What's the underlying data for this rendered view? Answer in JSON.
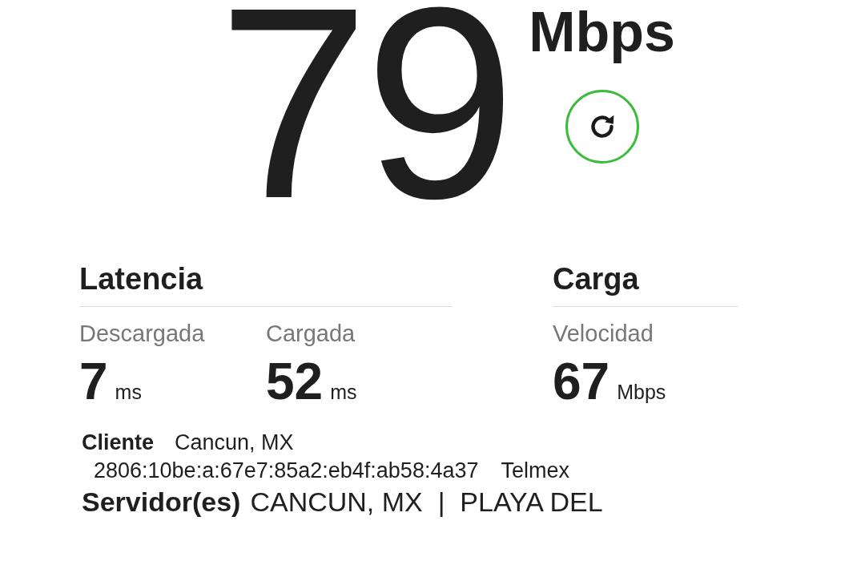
{
  "speed": {
    "value": "79",
    "unit": "Mbps"
  },
  "latency": {
    "title": "Latencia",
    "metrics": [
      {
        "label": "Descargada",
        "value": "7",
        "unit": "ms"
      },
      {
        "label": "Cargada",
        "value": "52",
        "unit": "ms"
      }
    ]
  },
  "upload": {
    "title": "Carga",
    "metrics": [
      {
        "label": "Velocidad",
        "value": "67",
        "unit": "Mbps"
      }
    ]
  },
  "client": {
    "label": "Cliente",
    "location": "Cancun, MX",
    "ip": "2806:10be:a:67e7:85a2:eb4f:ab58:4a37",
    "isp": "Telmex"
  },
  "servers": {
    "label": "Servidor(es)",
    "value": "CANCUN, MX  |  PLAYA DEL"
  }
}
